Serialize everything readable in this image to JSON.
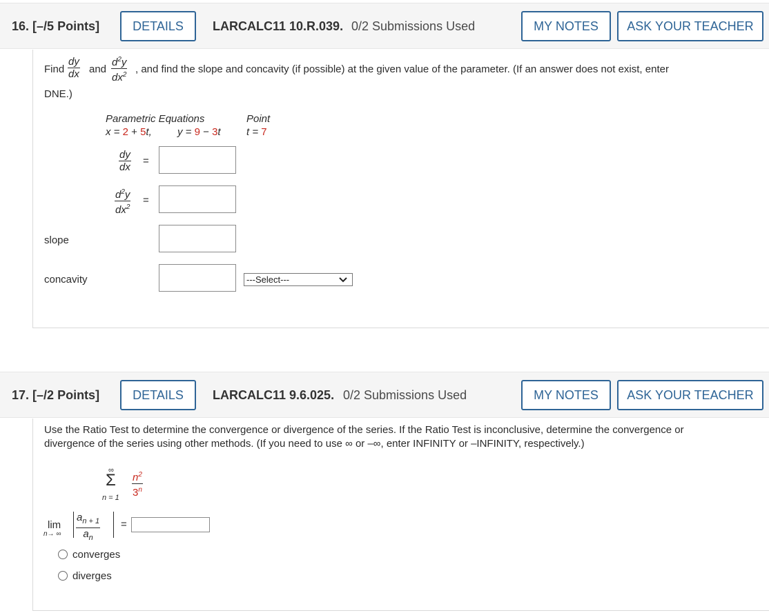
{
  "q16": {
    "number": "16.",
    "points": "[–/5 Points]",
    "details_label": "DETAILS",
    "code": "LARCALC11 10.R.039.",
    "submissions": "0/2 Submissions Used",
    "my_notes_label": "MY NOTES",
    "ask_teacher_label": "ASK YOUR TEACHER",
    "prompt_find": "Find",
    "prompt_and": "and",
    "prompt_rest": ", and find the slope and concavity (if possible) at the given value of the parameter. (If an answer does not exist, enter",
    "prompt_line2": "DNE.)",
    "header_equations": "Parametric Equations",
    "header_point": "Point",
    "eq_x_var": "x = ",
    "eq_x_const": "2",
    "eq_x_plus": " + ",
    "eq_x_coef": "5",
    "eq_x_t": "t,",
    "eq_y_var": "y = ",
    "eq_y_const": "9",
    "eq_y_minus": " − ",
    "eq_y_coef": "3",
    "eq_y_t": "t",
    "point_var": "t = ",
    "point_value": "7",
    "dy_num": "dy",
    "dy_den": "dx",
    "d2y_num": "d",
    "d2y_num_sup": "2",
    "d2y_num_y": "y",
    "d2y_den": "dx",
    "d2y_den_sup": "2",
    "equals": "=",
    "slope_label": "slope",
    "concavity_label": "concavity",
    "concavity_select_value": "---Select---",
    "dydx_value": "",
    "d2ydx2_value": "",
    "slope_value": "",
    "concavity_value": ""
  },
  "q17": {
    "number": "17.",
    "points": "[–/2 Points]",
    "details_label": "DETAILS",
    "code": "LARCALC11 9.6.025.",
    "submissions": "0/2 Submissions Used",
    "my_notes_label": "MY NOTES",
    "ask_teacher_label": "ASK YOUR TEACHER",
    "prompt_line1": "Use the Ratio Test to determine the convergence or divergence of the series. If the Ratio Test is inconclusive, determine the convergence or",
    "prompt_line2": "divergence of the series using other methods. (If you need to use ∞ or –∞, enter INFINITY or –INFINITY, respectively.)",
    "sigma": "Σ",
    "sum_upper": "∞",
    "sum_lower": "n = 1",
    "term_num": "n",
    "term_num_sup": "2",
    "term_den": "3",
    "term_den_sup": "n",
    "lim": "lim",
    "lim_sub": "n→ ∞",
    "ratio_num": "a",
    "ratio_num_sub": "n + 1",
    "ratio_den": "a",
    "ratio_den_sub": "n",
    "equals": "=",
    "limit_value": "",
    "options": [
      "converges",
      "diverges"
    ]
  }
}
